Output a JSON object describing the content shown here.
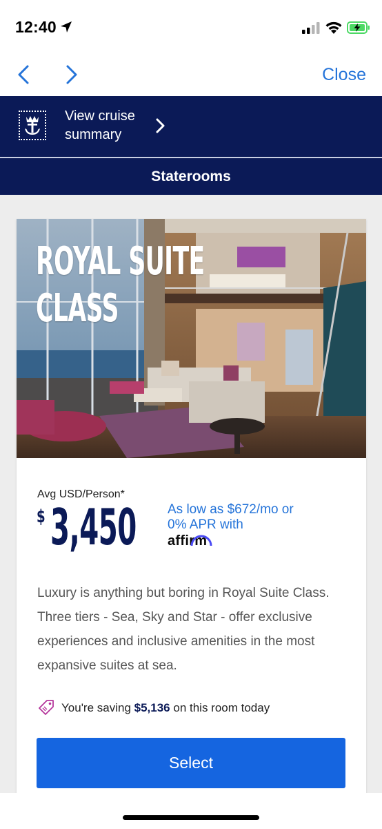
{
  "status_bar": {
    "time": "12:40",
    "icons": [
      "location-arrow-icon",
      "signal-icon",
      "wifi-icon",
      "battery-charging-icon"
    ],
    "battery_color": "#4cd964"
  },
  "nav": {
    "back_icon": "chevron-left-icon",
    "forward_icon": "chevron-right-icon",
    "close_label": "Close",
    "accent_color": "#2574d9"
  },
  "summary": {
    "logo_icon": "royal-caribbean-crown-anchor-icon",
    "label": "View cruise summary",
    "chevron_icon": "chevron-right-icon"
  },
  "staterooms": {
    "title": "Staterooms"
  },
  "card": {
    "hero_title_line1": "ROYAL SUITE",
    "hero_title_line2": "CLASS",
    "price_label": "Avg USD/Person*",
    "price_currency": "$",
    "price_amount": "3,450",
    "financing_text": "As low as $672/mo or 0% APR with",
    "financing_brand": "affirm",
    "description": "Luxury is anything but boring in Royal Suite Class. Three tiers - Sea, Sky and Star - offer exclusive experiences and inclusive amenities in the most expansive suites at sea.",
    "savings_prefix": "You're saving ",
    "savings_amount": "$5,136",
    "savings_suffix": " on this room today",
    "savings_icon": "price-tag-icon",
    "select_label": "Select",
    "brand_navy": "#0b1a57",
    "button_color": "#1565e0"
  }
}
